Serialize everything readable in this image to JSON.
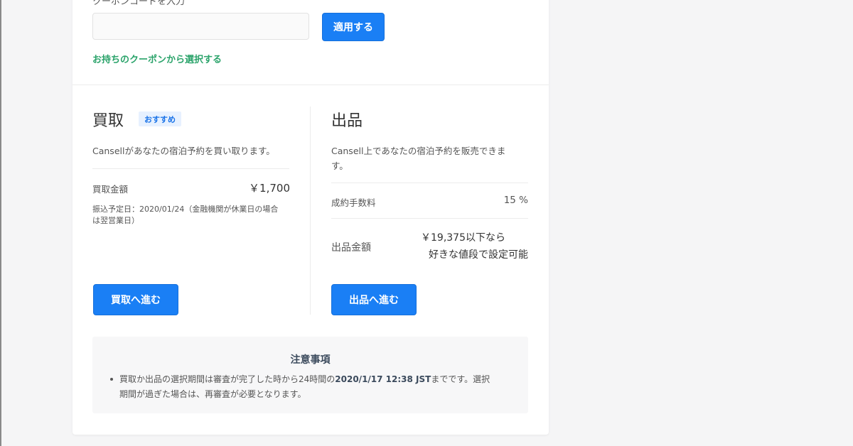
{
  "coupon": {
    "label": "クーポンコードを入力",
    "input_value": "",
    "apply_button": "適用する",
    "select_link": "お持ちのクーポンから選択する"
  },
  "buyback": {
    "title": "買取",
    "badge": "おすすめ",
    "description": "Cansellがあなたの宿泊予約を買い取ります。",
    "amount_label": "買取金額",
    "amount_value": "￥1,700",
    "transfer_note_line1": "振込予定日：2020/01/24（金融機関が休業日の場合",
    "transfer_note_line2": "は翌営業日）",
    "button": "買取へ進む"
  },
  "listing": {
    "title": "出品",
    "description_line1": "Cansell上であなたの宿泊予約を販売できま",
    "description_line2": "す。",
    "fee_label": "成約手数料",
    "fee_value": "15 %",
    "price_label": "出品金額",
    "price_value_line1": "￥19,375以下なら",
    "price_value_line2": "好きな値段で設定可能",
    "button": "出品へ進む"
  },
  "notice": {
    "title": "注意事項",
    "text_before": "買取か出品の選択期間は審査が完了した時から24時間の",
    "text_bold": "2020/1/17 12:38 JST",
    "text_after_line1": "までです。選択",
    "text_line2": "期間が過ぎた場合は、再審査が必要となります。"
  },
  "colors": {
    "primary_button": "#1a7ff5",
    "link_green": "#2aa36a",
    "badge_bg": "#e7f1ff"
  }
}
